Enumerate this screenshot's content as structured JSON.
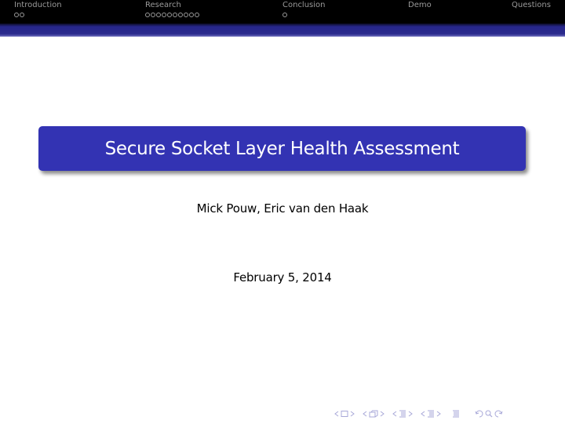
{
  "header": {
    "sections": [
      {
        "label": "Introduction",
        "dots": 2
      },
      {
        "label": "Research",
        "dots": 10
      },
      {
        "label": "Conclusion",
        "dots": 1
      },
      {
        "label": "Demo",
        "dots": 0
      },
      {
        "label": "Questions",
        "dots": 0
      }
    ]
  },
  "slide": {
    "title": "Secure Socket Layer Health Assessment",
    "authors": "Mick Pouw, Eric van den Haak",
    "date": "February 5, 2014"
  },
  "navigation_symbols": [
    {
      "name": "frame-prev-icon"
    },
    {
      "name": "frame-icon"
    },
    {
      "name": "frame-next-icon"
    },
    {
      "name": "subsection-prev-icon"
    },
    {
      "name": "subsection-icon"
    },
    {
      "name": "subsection-next-icon"
    },
    {
      "name": "section-prev-icon"
    },
    {
      "name": "section-icon"
    },
    {
      "name": "section-next-icon"
    },
    {
      "name": "document-icon"
    },
    {
      "name": "back-icon"
    },
    {
      "name": "search-icon"
    },
    {
      "name": "forward-icon"
    }
  ],
  "colors": {
    "headline_bg": "#000000",
    "band": "#2a2a8c",
    "title_box": "#3333b3",
    "nav_text": "#9a9a9a",
    "nav_symbols": "#a8a8d8"
  }
}
